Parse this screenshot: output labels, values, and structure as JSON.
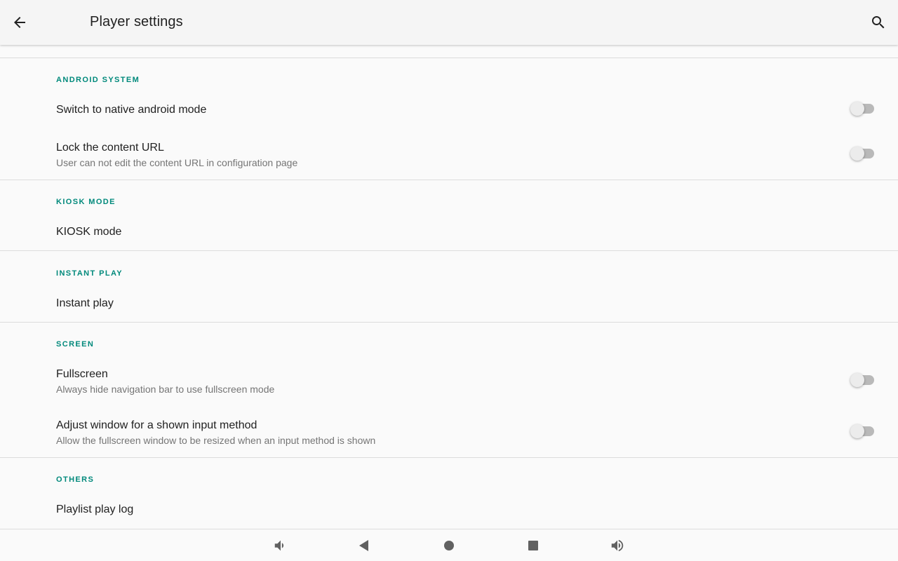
{
  "appbar": {
    "title": "Player settings",
    "back_icon": "arrow-left-icon",
    "search_icon": "search-icon"
  },
  "sections": {
    "android_system": {
      "header": "ANDROID SYSTEM",
      "native_mode": {
        "title": "Switch to native android mode",
        "enabled": false
      },
      "lock_url": {
        "title": "Lock the content URL",
        "summary": "User can not edit the content URL in configuration page",
        "enabled": false
      }
    },
    "kiosk": {
      "header": "KIOSK MODE",
      "kiosk_mode": {
        "title": "KIOSK mode"
      }
    },
    "instant_play": {
      "header": "INSTANT PLAY",
      "instant_play": {
        "title": "Instant play"
      }
    },
    "screen": {
      "header": "SCREEN",
      "fullscreen": {
        "title": "Fullscreen",
        "summary": "Always hide navigation bar to use fullscreen mode",
        "enabled": false
      },
      "adjust_window": {
        "title": "Adjust window for a shown input method",
        "summary": "Allow the fullscreen window to be resized when an input method is shown",
        "enabled": false
      }
    },
    "others": {
      "header": "OTHERS",
      "play_log": {
        "title": "Playlist play log"
      }
    }
  },
  "colors": {
    "accent": "#00897b",
    "appbar_bg": "#f5f5f5",
    "background": "#fafafa",
    "switch_track_off": "#b9b9b9",
    "switch_thumb_off": "#ececec"
  },
  "navbar": {
    "icons": [
      "volume-down-icon",
      "back-triangle-icon",
      "home-circle-icon",
      "recents-square-icon",
      "volume-up-icon"
    ]
  }
}
